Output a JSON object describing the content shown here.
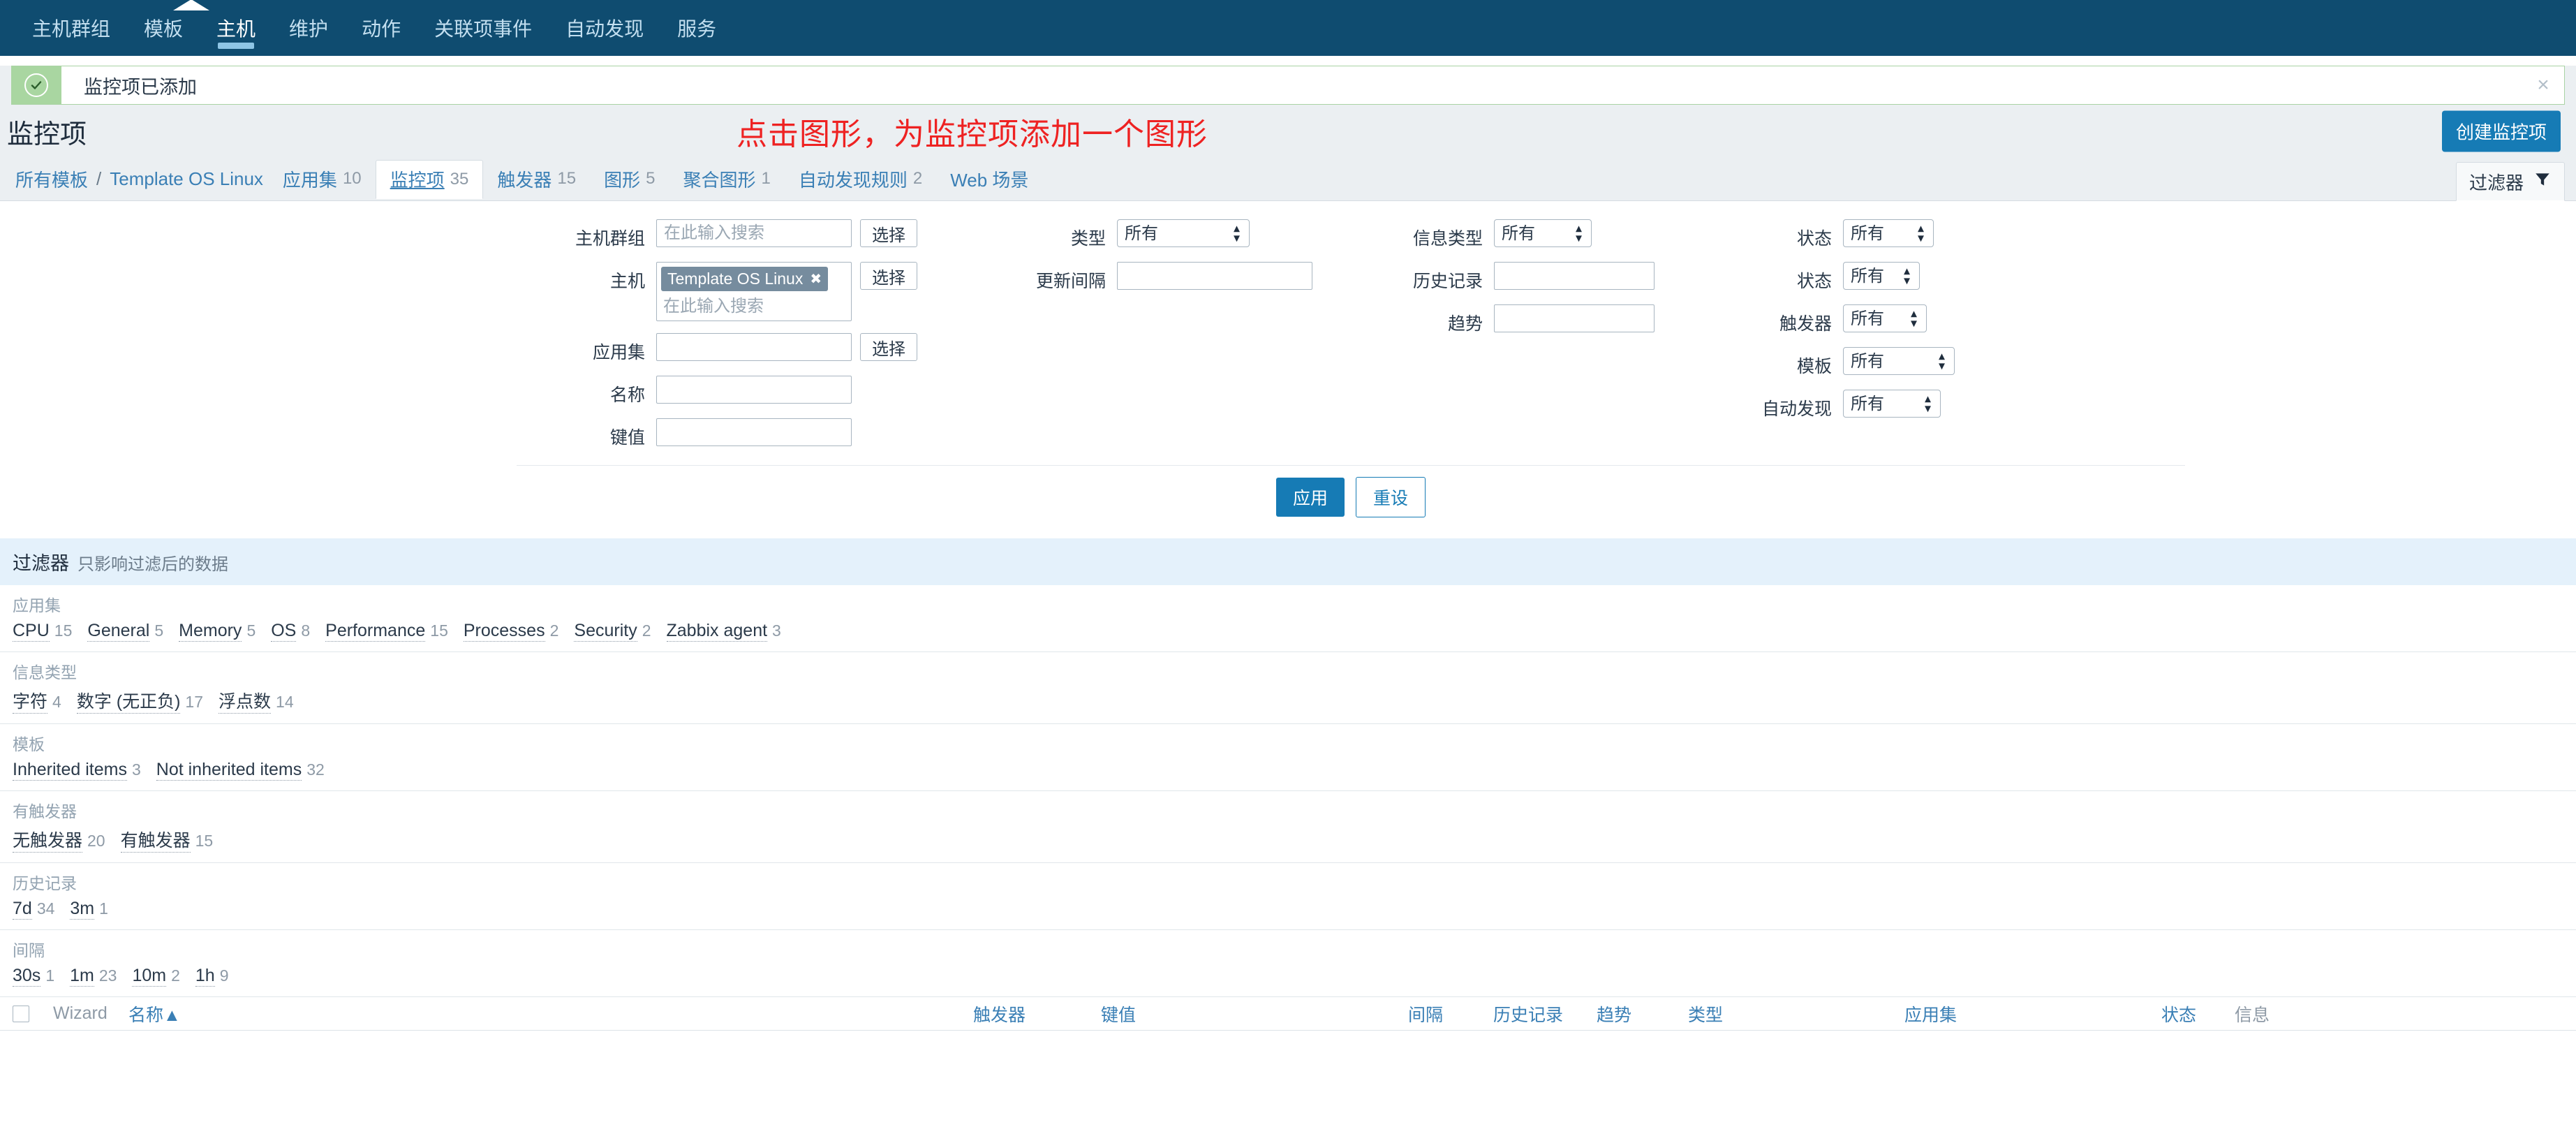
{
  "topnav": {
    "items": [
      {
        "label": "主机群组",
        "active": false
      },
      {
        "label": "模板",
        "active": false
      },
      {
        "label": "主机",
        "active": true
      },
      {
        "label": "维护",
        "active": false
      },
      {
        "label": "动作",
        "active": false
      },
      {
        "label": "关联项事件",
        "active": false
      },
      {
        "label": "自动发现",
        "active": false
      },
      {
        "label": "服务",
        "active": false
      }
    ]
  },
  "message": {
    "text": "监控项已添加",
    "close_label": "×",
    "icon": "check-circle-icon"
  },
  "header": {
    "title": "监控项",
    "annotation": "点击图形，为监控项添加一个图形",
    "create_button": "创建监控项"
  },
  "breadcrumb": {
    "all_templates": "所有模板",
    "separator": "/",
    "template": "Template OS Linux"
  },
  "tabs": [
    {
      "label": "应用集",
      "count": "10",
      "selected": false
    },
    {
      "label": "监控项",
      "count": "35",
      "selected": true
    },
    {
      "label": "触发器",
      "count": "15",
      "selected": false
    },
    {
      "label": "图形",
      "count": "5",
      "selected": false
    },
    {
      "label": "聚合图形",
      "count": "1",
      "selected": false
    },
    {
      "label": "自动发现规则",
      "count": "2",
      "selected": false
    },
    {
      "label": "Web 场景",
      "count": "",
      "selected": false
    }
  ],
  "filter_tab": {
    "label": "过滤器",
    "icon": "funnel-icon"
  },
  "filter": {
    "col1": [
      {
        "label": "主机群组",
        "type": "text",
        "value": "",
        "placeholder": "在此输入搜索",
        "button": "选择"
      },
      {
        "label": "主机",
        "type": "multiselect",
        "chip": "Template OS Linux",
        "chip_remove": "✖",
        "value": "",
        "placeholder": "在此输入搜索",
        "button": "选择"
      },
      {
        "label": "应用集",
        "type": "text",
        "value": "",
        "placeholder": "",
        "button": "选择"
      },
      {
        "label": "名称",
        "type": "text",
        "value": "",
        "placeholder": "",
        "button": ""
      },
      {
        "label": "键值",
        "type": "text",
        "value": "",
        "placeholder": "",
        "button": ""
      }
    ],
    "col2": [
      {
        "label": "类型",
        "type": "select",
        "value": "所有"
      },
      {
        "label": "更新间隔",
        "type": "text",
        "value": "",
        "placeholder": ""
      }
    ],
    "col3": [
      {
        "label": "信息类型",
        "type": "select",
        "value": "所有"
      },
      {
        "label": "历史记录",
        "type": "text",
        "value": "",
        "placeholder": ""
      },
      {
        "label": "趋势",
        "type": "text",
        "value": "",
        "placeholder": ""
      }
    ],
    "col4": [
      {
        "label": "状态",
        "type": "select",
        "value": "所有"
      },
      {
        "label": "状态",
        "type": "select",
        "value": "所有"
      },
      {
        "label": "触发器",
        "type": "select",
        "value": "所有"
      },
      {
        "label": "模板",
        "type": "select",
        "value": "所有"
      },
      {
        "label": "自动发现",
        "type": "select",
        "value": "所有"
      }
    ],
    "apply": "应用",
    "reset": "重设"
  },
  "subfilter": {
    "title": "过滤器",
    "subtitle": "只影响过滤后的数据",
    "sections": [
      {
        "title": "应用集",
        "links": [
          {
            "name": "CPU",
            "count": "15"
          },
          {
            "name": "General",
            "count": "5"
          },
          {
            "name": "Memory",
            "count": "5"
          },
          {
            "name": "OS",
            "count": "8"
          },
          {
            "name": "Performance",
            "count": "15"
          },
          {
            "name": "Processes",
            "count": "2"
          },
          {
            "name": "Security",
            "count": "2"
          },
          {
            "name": "Zabbix agent",
            "count": "3"
          }
        ]
      },
      {
        "title": "信息类型",
        "links": [
          {
            "name": "字符",
            "count": "4"
          },
          {
            "name": "数字 (无正负)",
            "count": "17"
          },
          {
            "name": "浮点数",
            "count": "14"
          }
        ]
      },
      {
        "title": "模板",
        "links": [
          {
            "name": "Inherited items",
            "count": "3"
          },
          {
            "name": "Not inherited items",
            "count": "32"
          }
        ]
      },
      {
        "title": "有触发器",
        "links": [
          {
            "name": "无触发器",
            "count": "20"
          },
          {
            "name": "有触发器",
            "count": "15"
          }
        ]
      },
      {
        "title": "历史记录",
        "links": [
          {
            "name": "7d",
            "count": "34"
          },
          {
            "name": "3m",
            "count": "1"
          }
        ]
      },
      {
        "title": "间隔",
        "links": [
          {
            "name": "30s",
            "count": "1"
          },
          {
            "name": "1m",
            "count": "23"
          },
          {
            "name": "10m",
            "count": "2"
          },
          {
            "name": "1h",
            "count": "9"
          }
        ]
      }
    ]
  },
  "table": {
    "columns": [
      {
        "label": "Wizard",
        "link": false,
        "sorted": false
      },
      {
        "label": "名称",
        "link": true,
        "sorted": true,
        "sort_arrow": "▲"
      },
      {
        "label": "触发器",
        "link": true,
        "sorted": false
      },
      {
        "label": "键值",
        "link": true,
        "sorted": false
      },
      {
        "label": "间隔",
        "link": true,
        "sorted": false
      },
      {
        "label": "历史记录",
        "link": true,
        "sorted": false
      },
      {
        "label": "趋势",
        "link": true,
        "sorted": false
      },
      {
        "label": "类型",
        "link": true,
        "sorted": false
      },
      {
        "label": "应用集",
        "link": true,
        "sorted": false
      },
      {
        "label": "状态",
        "link": true,
        "sorted": false
      },
      {
        "label": "信息",
        "link": false,
        "sorted": false
      }
    ]
  },
  "colors": {
    "nav_bg": "#0f4c70",
    "accent": "#167bb5",
    "link": "#3a7fb5",
    "annotation": "#ee2222",
    "success_green": "#a9d6a1",
    "subfilter_bg": "#e4f1fb"
  }
}
